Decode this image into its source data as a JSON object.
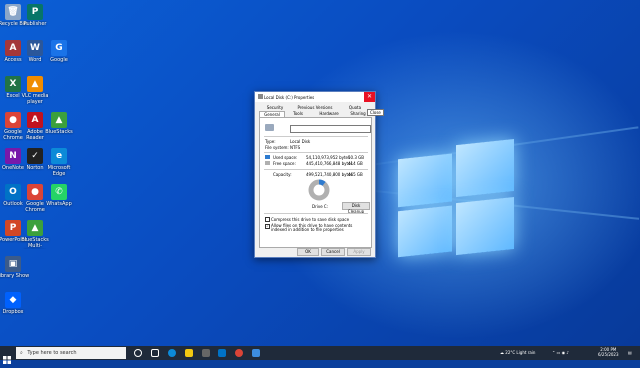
{
  "desktop_icons": [
    {
      "label": "Recycle Bin",
      "glyph": "🗑",
      "color": "#8aa6c8",
      "icon": "recycle-bin-icon"
    },
    {
      "label": "Publisher",
      "glyph": "P",
      "color": "#077568",
      "icon": "publisher-icon"
    },
    {
      "label": "Access",
      "glyph": "A",
      "color": "#a4373a",
      "icon": "access-icon"
    },
    {
      "label": "Word",
      "glyph": "W",
      "color": "#2b579a",
      "icon": "word-icon"
    },
    {
      "label": "Google",
      "glyph": "G",
      "color": "#1a73e8",
      "icon": "edge-icon"
    },
    {
      "label": "Excel",
      "glyph": "X",
      "color": "#217346",
      "icon": "excel-icon"
    },
    {
      "label": "VLC media player",
      "glyph": "▲",
      "color": "#f08c00",
      "icon": "vlc-icon"
    },
    {
      "label": "Google Chrome",
      "glyph": "●",
      "color": "#db4437",
      "icon": "chrome-icon"
    },
    {
      "label": "Adobe Reader",
      "glyph": "A",
      "color": "#c1121f",
      "icon": "adobe-icon"
    },
    {
      "label": "BlueStacks",
      "glyph": "▲",
      "color": "#3ca03c",
      "icon": "bluestacks-icon"
    },
    {
      "label": "OneNote",
      "glyph": "N",
      "color": "#7719aa",
      "icon": "onenote-icon"
    },
    {
      "label": "Norton",
      "glyph": "✓",
      "color": "#222",
      "icon": "norton-icon"
    },
    {
      "label": "Microsoft Edge",
      "glyph": "e",
      "color": "#0c8ad8",
      "icon": "edge-browser-icon"
    },
    {
      "label": "Outlook",
      "glyph": "O",
      "color": "#0072c6",
      "icon": "outlook-icon"
    },
    {
      "label": "Google Chrome",
      "glyph": "●",
      "color": "#db4437",
      "icon": "chrome2-icon"
    },
    {
      "label": "WhatsApp",
      "glyph": "✆",
      "color": "#25d366",
      "icon": "whatsapp-icon"
    },
    {
      "label": "PowerPoint",
      "glyph": "P",
      "color": "#d24726",
      "icon": "powerpoint-icon"
    },
    {
      "label": "BlueStacks Multi-Instance",
      "glyph": "▲",
      "color": "#3ca03c",
      "icon": "bluestacks-multi-icon"
    },
    {
      "label": "Library Show",
      "glyph": "▣",
      "color": "#3b5b8a",
      "icon": "library-icon"
    },
    {
      "label": "Dropbox",
      "glyph": "◆",
      "color": "#0061fe",
      "icon": "dropbox-icon"
    }
  ],
  "dialog": {
    "title": "Local Disk (C:) Properties",
    "close_glyph": "✕",
    "tooltip": "Close",
    "tabs_row1": [
      "Security",
      "Previous Versions",
      "Quota"
    ],
    "tabs_row2": [
      "General",
      "Tools",
      "Hardware",
      "Sharing"
    ],
    "type_label": "Type:",
    "type_value": "Local Disk",
    "fs_label": "File system:",
    "fs_value": "NTFS",
    "used_label": "Used space:",
    "used_bytes": "54,110,973,952 bytes",
    "used_gb": "50.3 GB",
    "free_label": "Free space:",
    "free_bytes": "445,410,766,848 bytes",
    "free_gb": "414 GB",
    "capacity_label": "Capacity:",
    "capacity_bytes": "499,521,740,800 bytes",
    "capacity_gb": "465 GB",
    "drive_label": "Drive C:",
    "disk_cleanup": "Disk Cleanup",
    "compress_label": "Compress this drive to save disk space",
    "index_label": "Allow files on this drive to have contents indexed in addition to file properties",
    "ok": "OK",
    "cancel": "Cancel",
    "apply": "Apply",
    "used_fraction": 0.108,
    "used_color": "#2e7bcf",
    "free_color": "#b0b0b0"
  },
  "taskbar": {
    "search_placeholder": "Type here to search",
    "weather": "22°C  Light rain",
    "time": "2:00 PM",
    "date": "6/25/2023"
  }
}
